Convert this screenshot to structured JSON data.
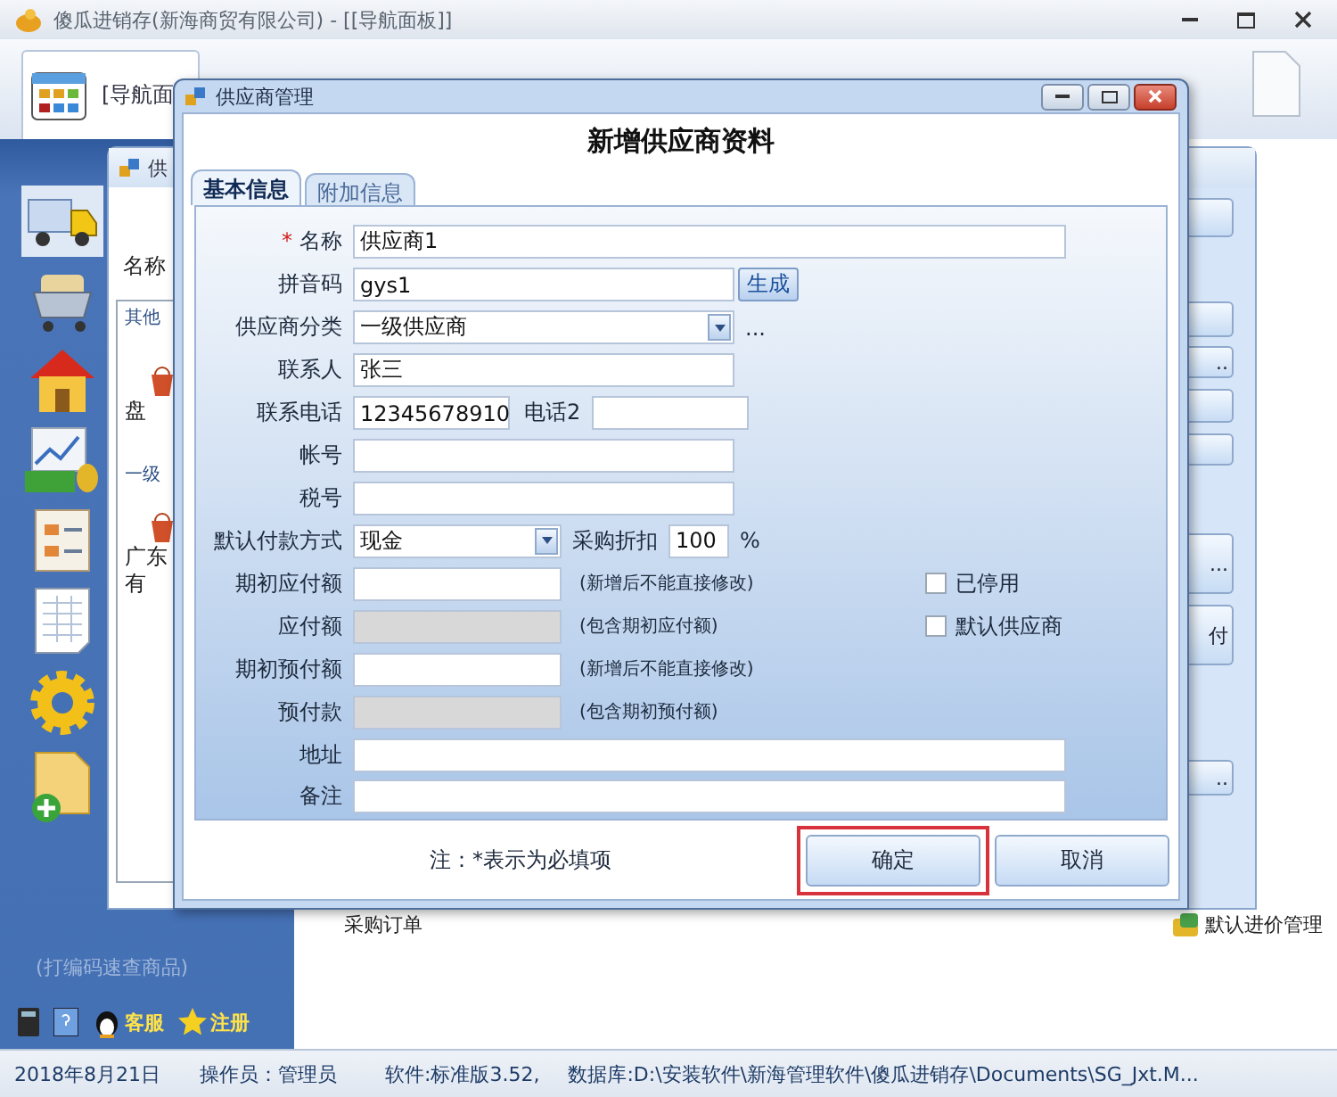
{
  "main_window": {
    "title": "傻瓜进销存(新海商贸有限公司) - [[导航面板]]"
  },
  "nav_tab": {
    "label": "[导航面",
    "selected": true
  },
  "sidebar": {
    "search_hint": "(打编码速查商品)",
    "links": [
      {
        "label": "客服"
      },
      {
        "label": "注册"
      }
    ]
  },
  "background_window": {
    "title": "供",
    "field_label": "名称",
    "list_items": [
      {
        "label": "其他",
        "kind": "group"
      },
      {
        "label": "盘",
        "kind": "item"
      },
      {
        "label": "一级",
        "kind": "group"
      },
      {
        "label": "广东",
        "kind": "item"
      },
      {
        "label": "有",
        "kind": "item"
      }
    ],
    "side_buttons": [
      "..",
      "...",
      "付",
      ".."
    ]
  },
  "content_items": [
    {
      "label": "采购订单"
    },
    {
      "label": "默认进价管理"
    }
  ],
  "dialog": {
    "title": "供应商管理",
    "heading": "新增供应商资料",
    "tabs": [
      {
        "label": "基本信息",
        "selected": true
      },
      {
        "label": "附加信息",
        "selected": false
      }
    ],
    "form": {
      "name": {
        "label": "名称",
        "required_mark": "*",
        "value": "供应商1"
      },
      "pinyin": {
        "label": "拼音码",
        "value": "gys1",
        "button": "生成"
      },
      "category": {
        "label": "供应商分类",
        "value": "一级供应商",
        "more": "..."
      },
      "contact": {
        "label": "联系人",
        "value": "张三"
      },
      "phone": {
        "label": "联系电话",
        "value": "12345678910"
      },
      "phone2": {
        "label": "电话2"
      },
      "account": {
        "label": "帐号"
      },
      "tax_id": {
        "label": "税号"
      },
      "payment": {
        "label": "默认付款方式",
        "value": "现金"
      },
      "discount": {
        "label": "采购折扣",
        "value": "100",
        "unit": "%"
      },
      "opening_payable": {
        "label": "期初应付额",
        "disabled": false,
        "note": "(新增后不能直接修改)"
      },
      "payable": {
        "label": "应付额",
        "disabled": true,
        "note": "(包含期初应付额)"
      },
      "opening_prepaid": {
        "label": "期初预付额",
        "disabled": false,
        "note": "(新增后不能直接修改)"
      },
      "prepaid": {
        "label": "预付款",
        "disabled": true,
        "note": "(包含期初预付额)"
      },
      "address": {
        "label": "地址"
      },
      "remark": {
        "label": "备注"
      }
    },
    "checkboxes": [
      {
        "label": "已停用",
        "checked": false
      },
      {
        "label": "默认供应商",
        "checked": false
      }
    ],
    "footer_note": "注：*表示为必填项",
    "buttons": [
      {
        "label": "确定",
        "highlighted": true
      },
      {
        "label": "取消",
        "highlighted": false
      }
    ]
  },
  "status_bar": [
    "2018年8月21日",
    "操作员：管理员",
    "软件:标准版3.52,",
    "数据库:D:\\安装软件\\新海管理软件\\傻瓜进销存\\Documents\\SG_Jxt.M..."
  ]
}
